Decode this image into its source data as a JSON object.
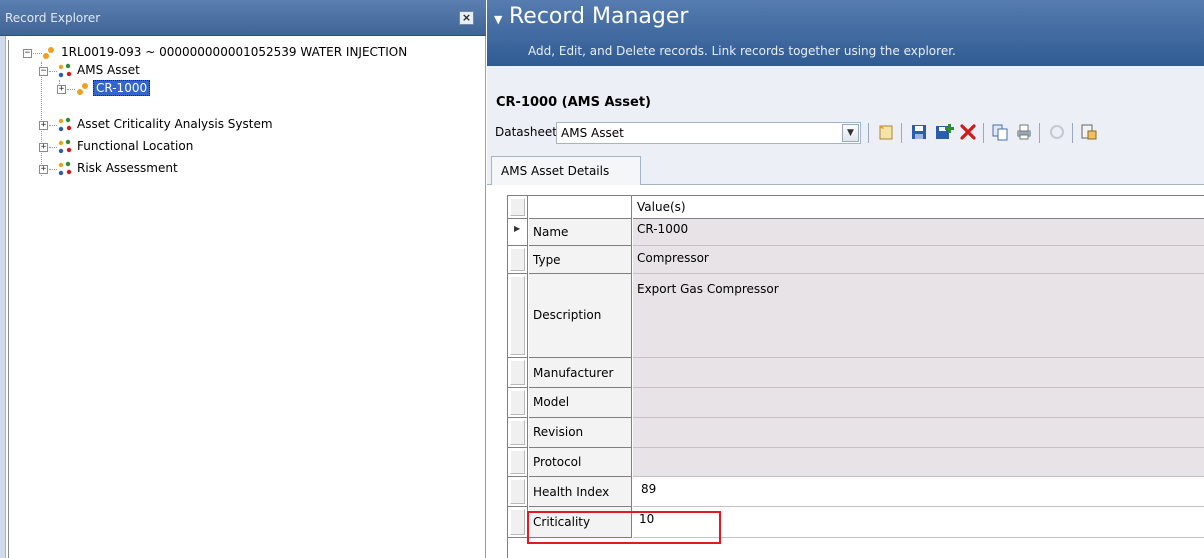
{
  "explorer": {
    "title": "Record Explorer",
    "close_label": "×",
    "tree": {
      "root": {
        "label": "1RL0019-093 ~ 000000000001052539 WATER INJECTION",
        "expander": "−"
      },
      "ams_asset": {
        "label": "AMS Asset",
        "expander": "−"
      },
      "cr1000": {
        "label": "CR-1000",
        "expander": "+"
      },
      "acas": {
        "label": "Asset Criticality Analysis System",
        "expander": "+"
      },
      "functional_location": {
        "label": "Functional Location",
        "expander": "+"
      },
      "risk_assessment": {
        "label": "Risk Assessment",
        "expander": "+"
      }
    }
  },
  "manager": {
    "caret": "▼",
    "title": "Record Manager",
    "subtitle": "Add, Edit, and Delete records. Link records together using the explorer.",
    "record_title": "CR-1000 (AMS Asset)",
    "datasheet_label": "Datasheet",
    "datasheet_value": "AMS Asset",
    "datasheet_dropdown_icon": "▼",
    "tab_label": "AMS Asset Details",
    "grid": {
      "value_header": "Value(s)",
      "rows": [
        {
          "name": "Name",
          "value": "CR-1000"
        },
        {
          "name": "Type",
          "value": "Compressor"
        },
        {
          "name": "Description",
          "value": "Export Gas Compressor"
        },
        {
          "name": "Manufacturer",
          "value": ""
        },
        {
          "name": "Model",
          "value": ""
        },
        {
          "name": "Revision",
          "value": ""
        },
        {
          "name": "Protocol",
          "value": ""
        },
        {
          "name": "Health Index",
          "value": "89"
        },
        {
          "name": "Criticality",
          "value": "10"
        }
      ]
    }
  },
  "icons": {
    "toolbar": [
      "new-record-icon",
      "save-icon",
      "add-link-icon",
      "delete-icon",
      "copy-icon",
      "print-icon",
      "disabled-icon",
      "reference-icon"
    ],
    "colors": {
      "delete": "#d11a1a",
      "save": "#2a5db0",
      "add": "#2e8b2e",
      "highlight": "#e01b24"
    }
  }
}
